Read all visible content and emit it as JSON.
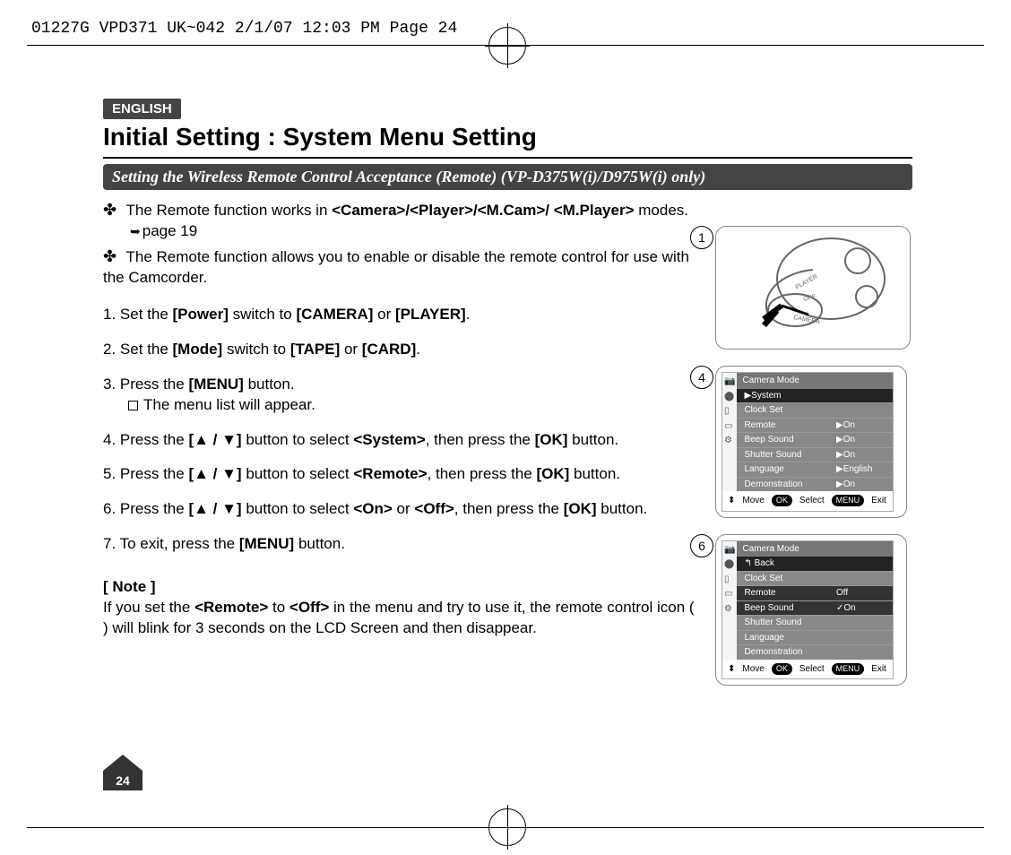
{
  "slug": "01227G VPD371 UK~042  2/1/07 12:03 PM  Page 24",
  "lang_badge": "ENGLISH",
  "title": "Initial Setting : System Menu Setting",
  "subhead": "Setting the Wireless Remote Control Acceptance (Remote) (VP-D375W(i)/D975W(i) only)",
  "intro1_pre": "The Remote function works in ",
  "intro1_bold": "<Camera>/<Player>/<M.Cam>/ <M.Player>",
  "intro1_post": " modes.",
  "intro1_ref": "page 19",
  "intro2": "The Remote function allows you to enable or disable the remote control for use with the Camcorder.",
  "steps": {
    "s1_a": "Set the ",
    "s1_b": "[Power]",
    "s1_c": " switch to ",
    "s1_d": "[CAMERA]",
    "s1_e": " or ",
    "s1_f": "[PLAYER]",
    "s1_g": ".",
    "s2_a": "Set the ",
    "s2_b": "[Mode]",
    "s2_c": " switch to ",
    "s2_d": "[TAPE]",
    "s2_e": " or ",
    "s2_f": "[CARD]",
    "s2_g": ".",
    "s3_a": "Press the ",
    "s3_b": "[MENU]",
    "s3_c": " button.",
    "s3_sub": "The menu list will appear.",
    "s4_a": "Press the ",
    "s4_b": "[▲ / ▼]",
    "s4_c": " button to select ",
    "s4_d": "<System>",
    "s4_e": ", then press the ",
    "s4_f": "[OK]",
    "s4_g": " button.",
    "s5_a": "Press the ",
    "s5_b": "[▲ / ▼]",
    "s5_c": " button to select ",
    "s5_d": "<Remote>",
    "s5_e": ", then press the ",
    "s5_f": "[OK]",
    "s5_g": " button.",
    "s6_a": "Press the ",
    "s6_b": "[▲ / ▼]",
    "s6_c": " button to select ",
    "s6_d": "<On>",
    "s6_e": " or ",
    "s6_f": "<Off>",
    "s6_g": ", then press the ",
    "s6_h": "[OK]",
    "s6_i": " button.",
    "s7_a": "To exit, press the ",
    "s7_b": "[MENU]",
    "s7_c": " button."
  },
  "note_head": "[ Note ]",
  "note_a": "If you set the ",
  "note_b": "<Remote>",
  "note_c": " to ",
  "note_d": "<Off>",
  "note_e": " in the menu and try to use it, the remote control icon (    ) will blink for 3 seconds on the LCD Screen and then disappear.",
  "page_number": "24",
  "fig1": {
    "num": "1",
    "dial": {
      "top": "PLAYER",
      "mid": "OFF",
      "bot": "CAMERA"
    }
  },
  "fig4": {
    "num": "4",
    "title": "Camera Mode",
    "crumb": "▶System",
    "rows": [
      {
        "lbl": "Clock Set",
        "val": ""
      },
      {
        "lbl": "Remote",
        "val": "▶On"
      },
      {
        "lbl": "Beep Sound",
        "val": "▶On"
      },
      {
        "lbl": "Shutter Sound",
        "val": "▶On"
      },
      {
        "lbl": "Language",
        "val": "▶English"
      },
      {
        "lbl": "Demonstration",
        "val": "▶On"
      }
    ],
    "footer": {
      "move": "Move",
      "ok": "OK",
      "select": "Select",
      "menu": "MENU",
      "exit": "Exit"
    }
  },
  "fig6": {
    "num": "6",
    "title": "Camera Mode",
    "crumb": "Back",
    "rows": [
      {
        "lbl": "Clock Set",
        "val": ""
      },
      {
        "lbl": "Remote",
        "val": "Off",
        "sel": true
      },
      {
        "lbl": "Beep Sound",
        "val": "✓On",
        "sel": true
      },
      {
        "lbl": "Shutter Sound",
        "val": ""
      },
      {
        "lbl": "Language",
        "val": ""
      },
      {
        "lbl": "Demonstration",
        "val": ""
      }
    ],
    "footer": {
      "move": "Move",
      "ok": "OK",
      "select": "Select",
      "menu": "MENU",
      "exit": "Exit"
    }
  }
}
